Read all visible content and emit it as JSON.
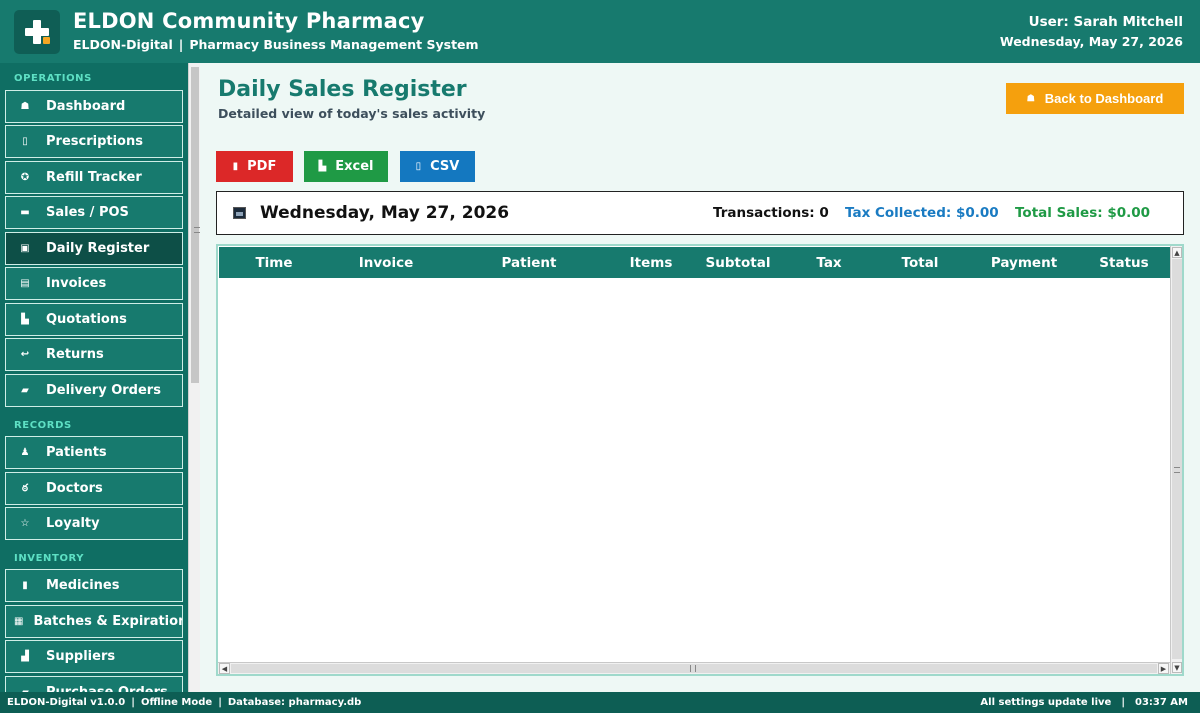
{
  "header": {
    "title": "ELDON Community Pharmacy",
    "brand": "ELDON-Digital",
    "subtitle": "Pharmacy Business Management System",
    "user": "User: Sarah Mitchell",
    "date": "Wednesday, May 27, 2026"
  },
  "sidebar": {
    "sections": {
      "operations": "OPERATIONS",
      "records": "RECORDS",
      "inventory": "INVENTORY"
    },
    "items": [
      {
        "label": "Dashboard",
        "icon": "home-icon",
        "glyph": "☗"
      },
      {
        "label": "Prescriptions",
        "icon": "clipboard-icon",
        "glyph": "▯"
      },
      {
        "label": "Refill Tracker",
        "icon": "refresh-icon",
        "glyph": "✪"
      },
      {
        "label": "Sales / POS",
        "icon": "register-icon",
        "glyph": "▬"
      },
      {
        "label": "Daily Register",
        "icon": "calendar-icon",
        "glyph": "▣"
      },
      {
        "label": "Invoices",
        "icon": "invoice-icon",
        "glyph": "▤"
      },
      {
        "label": "Quotations",
        "icon": "quote-icon",
        "glyph": "▙"
      },
      {
        "label": "Returns",
        "icon": "return-icon",
        "glyph": "↩"
      },
      {
        "label": "Delivery Orders",
        "icon": "truck-icon",
        "glyph": "▰"
      },
      {
        "label": "Patients",
        "icon": "people-icon",
        "glyph": "♟"
      },
      {
        "label": "Doctors",
        "icon": "stethoscope-icon",
        "glyph": "ఠ"
      },
      {
        "label": "Loyalty",
        "icon": "star-icon",
        "glyph": "☆"
      },
      {
        "label": "Medicines",
        "icon": "bottle-icon",
        "glyph": "▮"
      },
      {
        "label": "Batches & Expiration",
        "icon": "batch-icon",
        "glyph": "▦"
      },
      {
        "label": "Suppliers",
        "icon": "factory-icon",
        "glyph": "▟"
      },
      {
        "label": "Purchase Orders",
        "icon": "cart-icon",
        "glyph": "▰"
      }
    ]
  },
  "main": {
    "title": "Daily Sales Register",
    "subtitle": "Detailed view of today's sales activity",
    "back_button": "Back to Dashboard",
    "exports": {
      "pdf": "PDF",
      "excel": "Excel",
      "csv": "CSV"
    },
    "summary": {
      "date": "Wednesday, May 27, 2026",
      "transactions": "Transactions: 0",
      "tax": "Tax Collected: $0.00",
      "total": "Total Sales: $0.00"
    },
    "table": {
      "columns": [
        "Time",
        "Invoice",
        "Patient",
        "Items",
        "Subtotal",
        "Tax",
        "Total",
        "Payment",
        "Status"
      ],
      "rows": []
    }
  },
  "footer": {
    "version": "ELDON-Digital v1.0.0",
    "mode": "Offline Mode",
    "database": "Database: pharmacy.db",
    "settings": "All settings update live",
    "time": "03:37 AM"
  },
  "colors": {
    "primary": "#177a6e",
    "sidebar": "#0f6e63",
    "accent": "#f5a00d",
    "pdf": "#dc2828",
    "excel": "#1f9a45",
    "csv": "#1478c0"
  }
}
